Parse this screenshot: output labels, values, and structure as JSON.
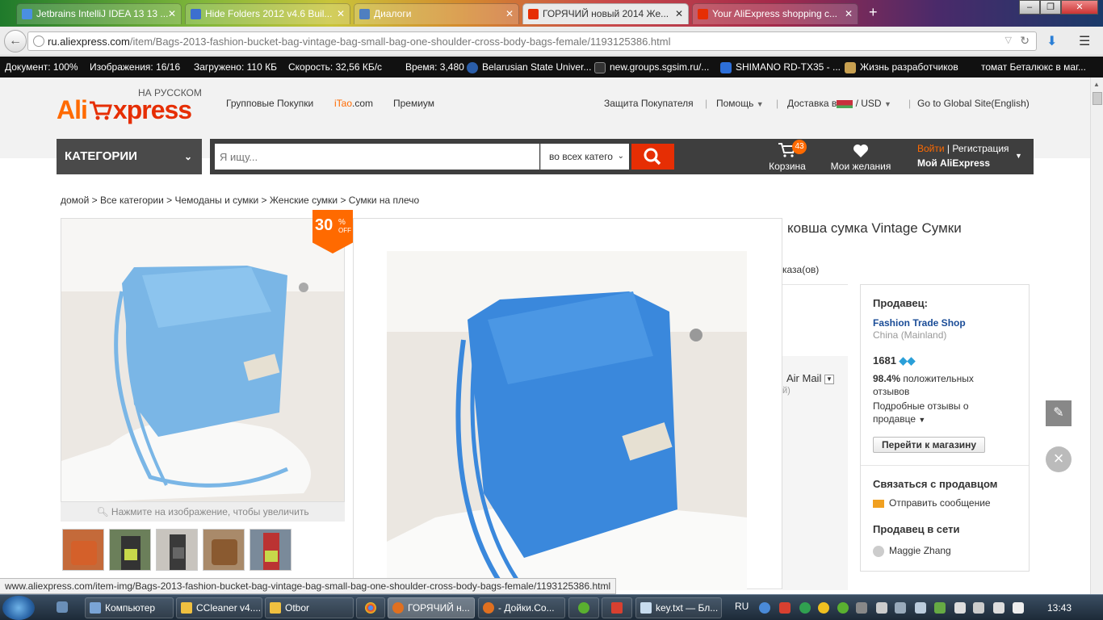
{
  "browser": {
    "tabs": [
      {
        "label": "Jetbrains IntelliJ IDEA 13 13 ...",
        "color": "#4a8fe0"
      },
      {
        "label": "Hide Folders 2012 v4.6 Buil...",
        "color": "#3c6fd0"
      },
      {
        "label": "Диалоги",
        "color": "#4f7fc0"
      },
      {
        "label": "ГОРЯЧИЙ новый 2014 Же...",
        "color": "#e62e04"
      },
      {
        "label": "Your AliExpress shopping c...",
        "color": "#e62e04"
      }
    ],
    "new_tab": "+",
    "url_domain": "ru.aliexpress.com",
    "url_path": "/item/Bags-2013-fashion-bucket-bag-vintage-bag-small-bag-one-shoulder-cross-body-bags-female/1193125386.html"
  },
  "statusbar": {
    "document": "Документ: 100%",
    "images": "Изображения: 16/16",
    "loaded": "Загружено: 110 КБ",
    "speed": "Скорость: 32,56 КБ/с",
    "time": "Время: 3,480",
    "bookmarks": [
      "Belarusian State Univer...",
      "new.groups.sgsim.ru/...",
      "SHIMANO RD-TX35 - ...",
      "Жизнь разработчиков",
      "томат Беталюкс в маг..."
    ]
  },
  "site": {
    "logo_ali": "Ali",
    "logo_express": "xpress",
    "logo_sub": "НА РУССКОМ",
    "nav": [
      "Групповые Покупки",
      "iTao.com",
      "Премиум"
    ],
    "itao_prefix": "i",
    "itao_mid": "Tao",
    "itao_suffix": ".com",
    "top_right": {
      "protection": "Защита Покупателя",
      "help": "Помощь",
      "ship_to": "Доставка в",
      "currency": "/ USD",
      "global": "Go to Global Site(English)"
    },
    "categories_label": "КАТЕГОРИИ",
    "search_placeholder": "Я ищу...",
    "search_scope": "во всех катего",
    "cart_label": "Корзина",
    "cart_count": "43",
    "wishlist_label": "Мои желания",
    "signin": "Войти",
    "register": "Регистрация",
    "my_ali": "Мой AliExpress"
  },
  "breadcrumb": "домой > Все категории > Чемоданы и сумки > Женские сумки > Сумки на плечо",
  "product": {
    "discount": "30",
    "discount_pct": "%",
    "discount_off": "OFF",
    "zoom_hint": "Нажмите на изображение, чтобы увеличить",
    "title_partial": "ковша сумка Vintage Сумки",
    "orders_partial": "каза(ов)",
    "shipping_method": "Air Mail",
    "shipping_note": "й)"
  },
  "seller": {
    "heading": "Продавец:",
    "shop_name": "Fashion Trade Shop",
    "location": "China (Mainland)",
    "score": "1681",
    "positive_pct": "98.4%",
    "positive_text": "положительных",
    "positive_text2": "отзывов",
    "detailed_reviews": "Подробные отзывы о",
    "detailed_reviews2": "продавце",
    "go_to_store": "Перейти к магазину",
    "contact_heading": "Связаться с продавцом",
    "send_message": "Отправить сообщение",
    "online_heading": "Продавец в сети",
    "online_person": "Maggie Zhang"
  },
  "hover_url": "www.aliexpress.com/item-img/Bags-2013-fashion-bucket-bag-vintage-bag-small-bag-one-shoulder-cross-body-bags-female/1193125386.html",
  "taskbar": {
    "items": [
      "Компьютер",
      "CCleaner v4....",
      "Otbor",
      "",
      "ГОРЯЧИЙ н...",
      "- Дойки.Со...",
      "",
      "",
      "key.txt — Бл..."
    ],
    "lang": "RU",
    "time": "13:43"
  },
  "colors": {
    "accent": "#e62e04",
    "orange": "#ff6a00",
    "seller_link": "#1a4c97"
  }
}
